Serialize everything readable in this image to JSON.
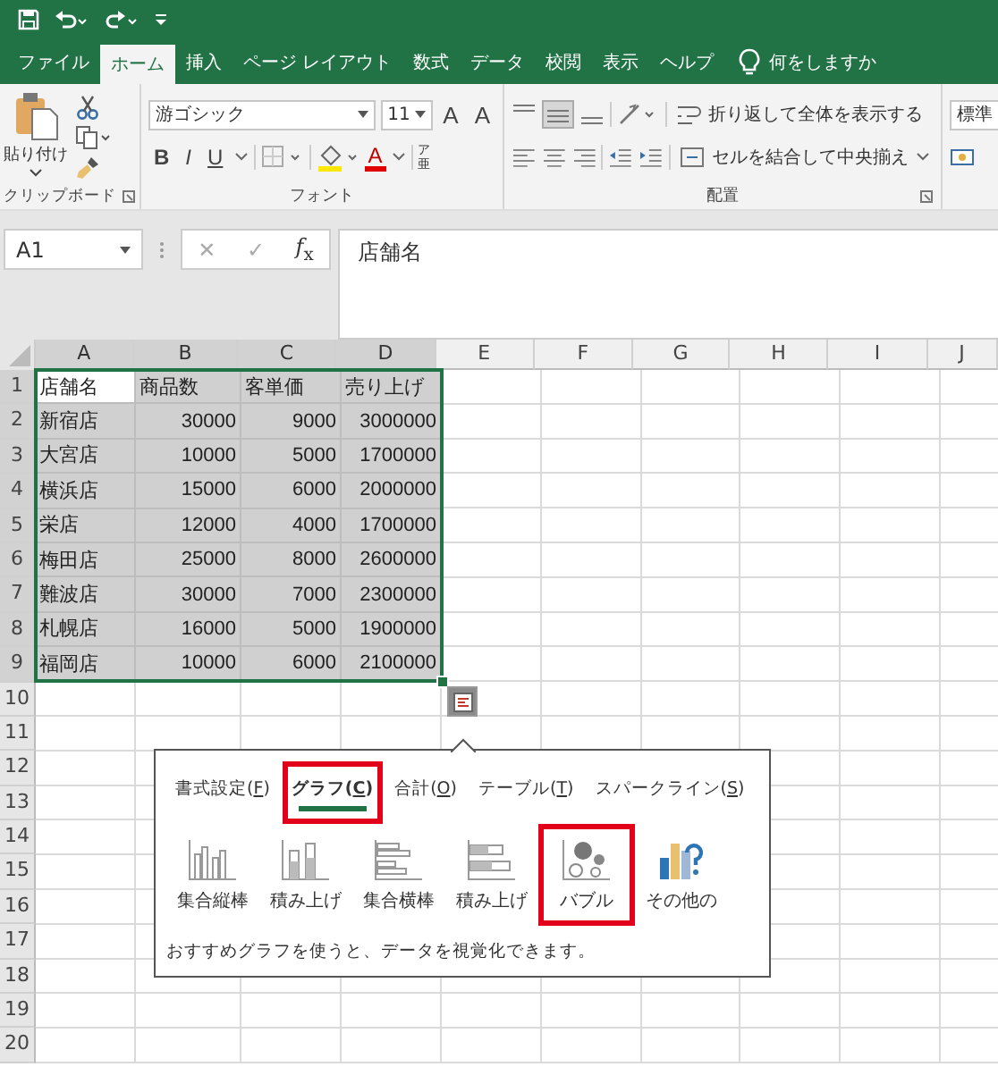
{
  "ribbon_tabs": [
    {
      "label": "ファイル",
      "selected": false
    },
    {
      "label": "ホーム",
      "selected": true
    },
    {
      "label": "挿入",
      "selected": false
    },
    {
      "label": "ページ レイアウト",
      "selected": false
    },
    {
      "label": "数式",
      "selected": false
    },
    {
      "label": "データ",
      "selected": false
    },
    {
      "label": "校閲",
      "selected": false
    },
    {
      "label": "表示",
      "selected": false
    },
    {
      "label": "ヘルプ",
      "selected": false
    }
  ],
  "tell_me": {
    "placeholder": "何をしますか"
  },
  "ribbon": {
    "clipboard": {
      "paste": "貼り付け",
      "group_label": "クリップボード"
    },
    "font": {
      "family": "游ゴシック",
      "size": "11",
      "grow": "A",
      "shrink": "A",
      "bold": "B",
      "italic": "I",
      "underline": "U",
      "font_color": "A",
      "phonetic": [
        "ア",
        "亜"
      ],
      "group_label": "フォント"
    },
    "alignment": {
      "wrap_text": "折り返して全体を表示する",
      "merge_center": "セルを結合して中央揃え",
      "group_label": "配置"
    },
    "number": {
      "format": "標準"
    }
  },
  "formula_bar": {
    "name_box": "A1",
    "cancel": "✕",
    "enter": "✓",
    "function": "*f*$_{x}$",
    "value": "店舗名"
  },
  "columns": [
    {
      "label": "A",
      "selected": true
    },
    {
      "label": "B",
      "selected": true
    },
    {
      "label": "C",
      "selected": true
    },
    {
      "label": "D",
      "selected": true
    },
    {
      "label": "E",
      "selected": false
    },
    {
      "label": "F",
      "selected": false
    },
    {
      "label": "G",
      "selected": false
    },
    {
      "label": "H",
      "selected": false
    },
    {
      "label": "I",
      "selected": false
    },
    {
      "label": "J",
      "selected": false
    }
  ],
  "rows": [
    {
      "number": "1",
      "selected": true,
      "cells": [
        "店舗名",
        "商品数",
        "客単価",
        "売り上げ"
      ]
    },
    {
      "number": "2",
      "selected": true,
      "cells": [
        "新宿店",
        "30000",
        "9000",
        "3000000"
      ]
    },
    {
      "number": "3",
      "selected": true,
      "cells": [
        "大宮店",
        "10000",
        "5000",
        "1700000"
      ]
    },
    {
      "number": "4",
      "selected": true,
      "cells": [
        "横浜店",
        "15000",
        "6000",
        "2000000"
      ]
    },
    {
      "number": "5",
      "selected": true,
      "cells": [
        "栄店",
        "12000",
        "4000",
        "1700000"
      ]
    },
    {
      "number": "6",
      "selected": true,
      "cells": [
        "梅田店",
        "25000",
        "8000",
        "2600000"
      ]
    },
    {
      "number": "7",
      "selected": true,
      "cells": [
        "難波店",
        "30000",
        "7000",
        "2300000"
      ]
    },
    {
      "number": "8",
      "selected": true,
      "cells": [
        "札幌店",
        "16000",
        "5000",
        "1900000"
      ]
    },
    {
      "number": "9",
      "selected": true,
      "cells": [
        "福岡店",
        "10000",
        "6000",
        "2100000"
      ]
    },
    {
      "number": "10",
      "selected": false
    },
    {
      "number": "11",
      "selected": false
    },
    {
      "number": "12",
      "selected": false
    },
    {
      "number": "13",
      "selected": false
    },
    {
      "number": "14",
      "selected": false
    },
    {
      "number": "15",
      "selected": false
    },
    {
      "number": "16",
      "selected": false
    },
    {
      "number": "17",
      "selected": false
    },
    {
      "number": "18",
      "selected": false
    },
    {
      "number": "19",
      "selected": false
    },
    {
      "number": "20",
      "selected": false
    }
  ],
  "quick_analysis": {
    "tabs": [
      {
        "text": "書式設定(",
        "key": "F",
        "end": ")",
        "selected": false,
        "highlighted": false
      },
      {
        "text": "グラフ(",
        "key": "C",
        "end": ")",
        "selected": true,
        "highlighted": true
      },
      {
        "text": "合計(",
        "key": "O",
        "end": ")",
        "selected": false,
        "highlighted": false
      },
      {
        "text": "テーブル(",
        "key": "T",
        "end": ")",
        "selected": false,
        "highlighted": false
      },
      {
        "text": "スパークライン(",
        "key": "S",
        "end": ")",
        "selected": false,
        "highlighted": false
      }
    ],
    "options": [
      {
        "label": "集合縦棒",
        "kind": "column",
        "highlighted": false
      },
      {
        "label": "積み上げ",
        "kind": "stacked-column",
        "highlighted": false
      },
      {
        "label": "集合横棒",
        "kind": "bar",
        "highlighted": false
      },
      {
        "label": "積み上げ",
        "kind": "stacked-bar",
        "highlighted": false
      },
      {
        "label": "バブル",
        "kind": "bubble",
        "highlighted": true
      },
      {
        "label": "その他の",
        "kind": "more",
        "highlighted": false
      }
    ],
    "hint": "おすすめグラフを使うと、データを視覚化できます。"
  }
}
